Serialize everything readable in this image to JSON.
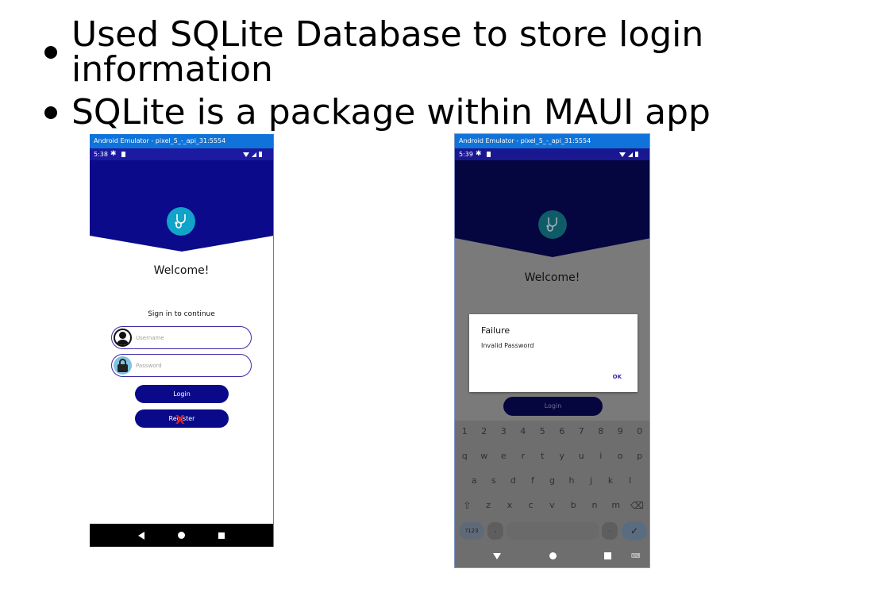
{
  "slide": {
    "bullets": [
      "Used SQLite Database to store login information",
      "SQLite is a package within MAUI app"
    ]
  },
  "emulator_left": {
    "window_title": "Android Emulator - pixel_5_-_api_31:5554",
    "status_time": "5:38",
    "welcome": "Welcome!",
    "subtitle": "Sign in to continue",
    "username_placeholder": "Username",
    "password_placeholder": "Password",
    "login_label": "Login",
    "register_label": "Register",
    "annotation_mark": "X",
    "colors": {
      "header": "#0a0a8a",
      "button": "#09098a",
      "titlebar": "#0f73d9",
      "annotation": "#e0201b"
    },
    "icons": [
      "settings-icon",
      "sd-card-icon",
      "wifi-icon",
      "signal-icon",
      "battery-icon",
      "stethoscope-logo-icon",
      "user-avatar-icon",
      "lock-icon",
      "back-icon",
      "home-icon",
      "recents-icon"
    ]
  },
  "emulator_right": {
    "window_title": "Android Emulator - pixel_5_-_api_31:5554",
    "status_time": "5:39",
    "welcome": "Welcome!",
    "login_label": "Login",
    "dialog": {
      "title": "Failure",
      "message": "Invalid Password",
      "ok_label": "OK"
    },
    "keyboard": {
      "row1": [
        "1",
        "2",
        "3",
        "4",
        "5",
        "6",
        "7",
        "8",
        "9",
        "0"
      ],
      "row2": [
        "q",
        "w",
        "e",
        "r",
        "t",
        "y",
        "u",
        "i",
        "o",
        "p"
      ],
      "row3": [
        "a",
        "s",
        "d",
        "f",
        "g",
        "h",
        "j",
        "k",
        "l"
      ],
      "row4": [
        "z",
        "x",
        "c",
        "v",
        "b",
        "n",
        "m"
      ],
      "symbols_label": "?123",
      "comma": ",",
      "period": "."
    }
  }
}
